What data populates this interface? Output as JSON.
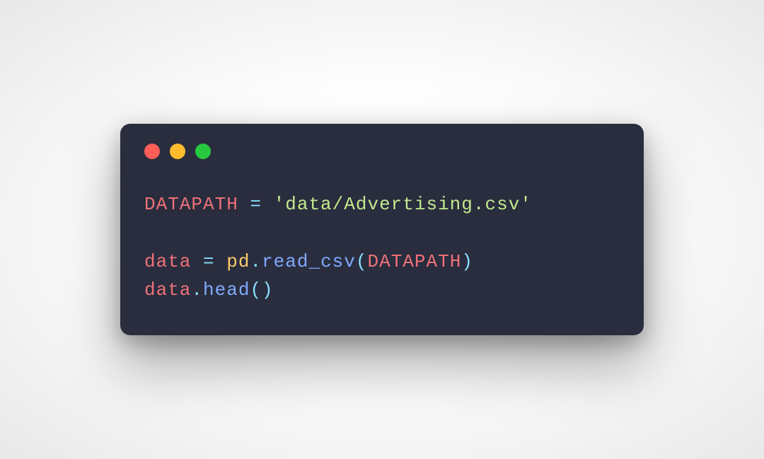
{
  "window": {
    "traffic_lights": {
      "red": "#ff5f56",
      "yellow": "#ffbd2e",
      "green": "#27c93f"
    }
  },
  "code": {
    "line1": {
      "const": "DATAPATH",
      "sp_eq_sp": " = ",
      "string": "'data/Advertising.csv'"
    },
    "blank": "",
    "line3": {
      "var": "data",
      "sp_eq_sp": " = ",
      "ns": "pd",
      "dot": ".",
      "func": "read_csv",
      "lparen": "(",
      "arg": "DATAPATH",
      "rparen": ")"
    },
    "line4": {
      "var": "data",
      "dot": ".",
      "func": "head",
      "parens": "()"
    }
  }
}
